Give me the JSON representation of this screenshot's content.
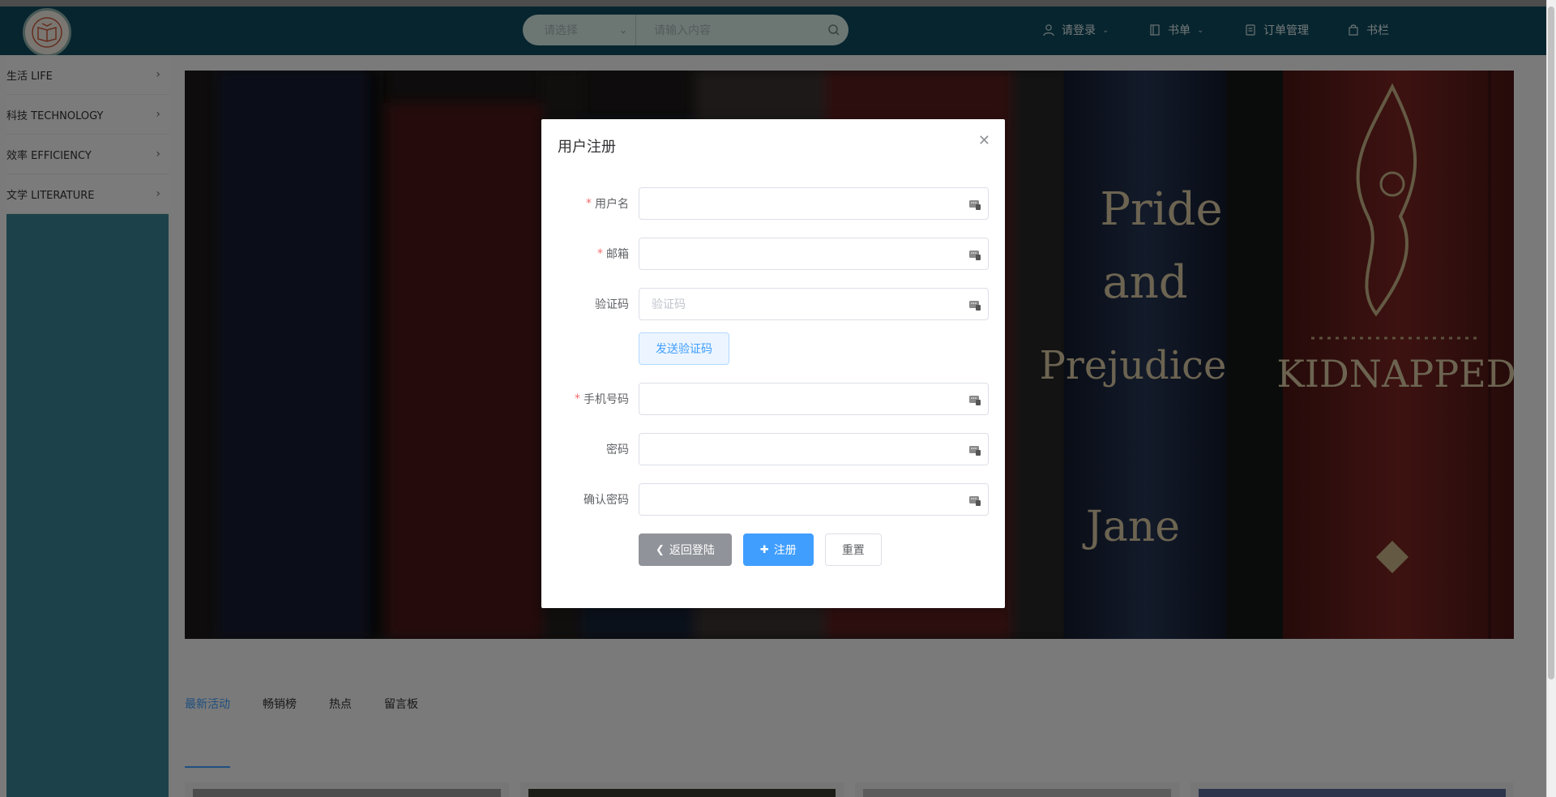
{
  "header": {
    "search": {
      "select_placeholder": "请选择",
      "input_placeholder": "请输入内容"
    },
    "nav": {
      "login": "请登录",
      "booklist": "书单",
      "orders": "订单管理",
      "bookshelf": "书栏"
    }
  },
  "sidebar": {
    "items": [
      {
        "label": "生活 LIFE"
      },
      {
        "label": "科技 TECHNOLOGY"
      },
      {
        "label": "效率 EFFICIENCY"
      },
      {
        "label": "文学 LITERATURE"
      }
    ]
  },
  "banner": {
    "book_titles": [
      "Pride and Prejudice",
      "Jane",
      "KIDNAPPED"
    ]
  },
  "tabs": [
    {
      "label": "最新活动"
    },
    {
      "label": "畅销榜"
    },
    {
      "label": "热点"
    },
    {
      "label": "留言板"
    }
  ],
  "dialog": {
    "title": "用户注册",
    "fields": {
      "username": {
        "label": "用户名",
        "required": true,
        "value": ""
      },
      "email": {
        "label": "邮箱",
        "required": true,
        "value": ""
      },
      "code": {
        "label": "验证码",
        "required": false,
        "placeholder": "验证码"
      },
      "phone": {
        "label": "手机号码",
        "required": true,
        "value": ""
      },
      "password": {
        "label": "密码",
        "required": false,
        "value": ""
      },
      "confirm": {
        "label": "确认密码",
        "required": false,
        "value": ""
      }
    },
    "send_code": "发送验证码",
    "back": "返回登陆",
    "register": "注册",
    "reset": "重置"
  },
  "colors": {
    "header_bg": "#0e4a5e",
    "sidebar_bg": "#3a8294",
    "primary": "#409eff",
    "required": "#f56c6c"
  }
}
